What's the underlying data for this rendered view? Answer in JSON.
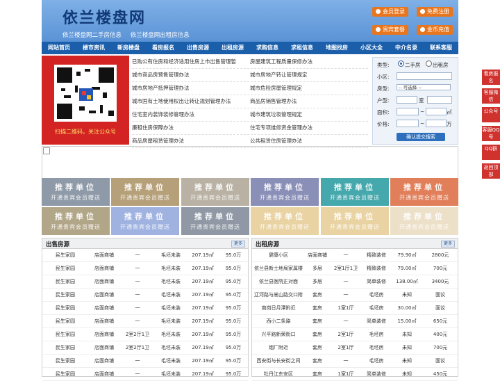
{
  "header": {
    "logo": "依兰楼盘网",
    "sub": [
      "依兰楼盘网二手房信息",
      "依兰楼盘网出租房信息"
    ],
    "buttons": [
      "会员登录",
      "免费注册",
      "贵宾套餐",
      "金币充值"
    ]
  },
  "nav": [
    "网站首页",
    "楼市资讯",
    "新房楼盘",
    "看房报名",
    "出售房源",
    "出租房源",
    "求购信息",
    "求租信息",
    "地图找房",
    "小区大全",
    "中介名录",
    "联系客服"
  ],
  "qr": {
    "caption": "扫描二维码，关注公众号"
  },
  "links": [
    [
      "已购公有住房和经济适用住房上市出售管理暂",
      "房屋建筑工程质量保修办法"
    ],
    [
      "城市商品房预售管理办法",
      "城市房地产转让管理规定"
    ],
    [
      "城市房地产抵押管理办法",
      "城市危险房屋管理规定"
    ],
    [
      "城市国有土地使用权出让转让规划管理办法",
      "商品房销售管理办法"
    ],
    [
      "住宅室内装饰装修管理办法",
      "城市建筑垃圾管理规定"
    ],
    [
      "廉租住房保障办法",
      "住宅专项维修资金管理办法"
    ],
    [
      "商品房屋租赁管理办法",
      "公共租赁住房管理办法"
    ]
  ],
  "search": {
    "type_label": "类型:",
    "opt1": "二手房",
    "opt2": "出租房",
    "community_label": "小区:",
    "house_label": "房型:",
    "house_select": "-- 可选择 --",
    "layout_label": "户型:",
    "room_unit": "室",
    "area_label": "面积:",
    "area_sep": "~",
    "area_unit": "㎡",
    "price_label": "价格:",
    "price_sep": "~",
    "price_unit": "万",
    "submit": "确认提交搜索"
  },
  "tiles": {
    "t1": "推荐单位",
    "t2": "开通贵宾会员赠送",
    "colors": [
      "#8e9aa8",
      "#b6a079",
      "#b9b2a4",
      "#8a8fb8",
      "#45a8ad",
      "#e07f5a",
      "#b2a688",
      "#9fb2e0",
      "#8f98a4",
      "#e9d3a2",
      "#e9d3a2",
      "#ede0c8"
    ]
  },
  "sale": {
    "title": "出售房源",
    "more": "更多",
    "rows": [
      [
        "民生家园",
        "店面商铺",
        "一",
        "毛坯未装",
        "207.19㎡",
        "95.0万"
      ],
      [
        "民生家园",
        "店面商铺",
        "一",
        "毛坯未装",
        "207.19㎡",
        "95.0万"
      ],
      [
        "民生家园",
        "店面商铺",
        "一",
        "毛坯未装",
        "207.19㎡",
        "95.0万"
      ],
      [
        "民生家园",
        "店面商铺",
        "一",
        "毛坯未装",
        "207.19㎡",
        "95.0万"
      ],
      [
        "民生家园",
        "店面商铺",
        "一",
        "毛坯未装",
        "207.19㎡",
        "95.0万"
      ],
      [
        "民生家园",
        "店面商铺",
        "一",
        "毛坯未装",
        "207.19㎡",
        "95.0万"
      ],
      [
        "民生家园",
        "店面商铺",
        "2室2厅1卫",
        "毛坯未装",
        "207.19㎡",
        "95.0万"
      ],
      [
        "民生家园",
        "店面商铺",
        "2室2厅1卫",
        "毛坯未装",
        "207.19㎡",
        "95.0万"
      ],
      [
        "民生家园",
        "店面商铺",
        "一",
        "毛坯未装",
        "207.19㎡",
        "95.0万"
      ],
      [
        "民生家园",
        "店面商铺",
        "一",
        "毛坯未装",
        "207.19㎡",
        "95.0万"
      ]
    ]
  },
  "rent": {
    "title": "出租房源",
    "more": "更多",
    "rows": [
      [
        "健康小区",
        "店面商铺",
        "一",
        "精致装修",
        "79.90㎡",
        "2800元"
      ],
      [
        "依兰县新土地局家属楼",
        "多层",
        "2室1厅1卫",
        "精致装修",
        "79.00㎡",
        "700元"
      ],
      [
        "依兰县医院正对面",
        "多层",
        "一",
        "简单装修",
        "138.00㎡",
        "3400元"
      ],
      [
        "辽河路与嵩山路交口附",
        "套房",
        "一",
        "毛坯房",
        "未知",
        "面议"
      ],
      [
        "南岗日月潭附近",
        "套房",
        "1室1厅",
        "毛坯房",
        "30.00㎡",
        "面议"
      ],
      [
        "西小二条路",
        "套房",
        "一",
        "简单装修",
        "15.00㎡",
        "650元"
      ],
      [
        "兴平路新荣街口",
        "套房",
        "2室1厅",
        "毛坯房",
        "未知",
        "400元"
      ],
      [
        "烟厂附近",
        "套房",
        "2室1厅",
        "毛坯房",
        "未知",
        "700元"
      ],
      [
        "西安街与长安街之间",
        "套房",
        "一",
        "毛坯房",
        "未知",
        "面议"
      ],
      [
        "牡丹江东安区",
        "套房",
        "1室1厅",
        "简单装修",
        "未知",
        "450元"
      ]
    ]
  },
  "side": [
    "看房报名",
    "客服微信",
    "公众号",
    "客服QQ号",
    "QQ群",
    "返回顶部"
  ]
}
